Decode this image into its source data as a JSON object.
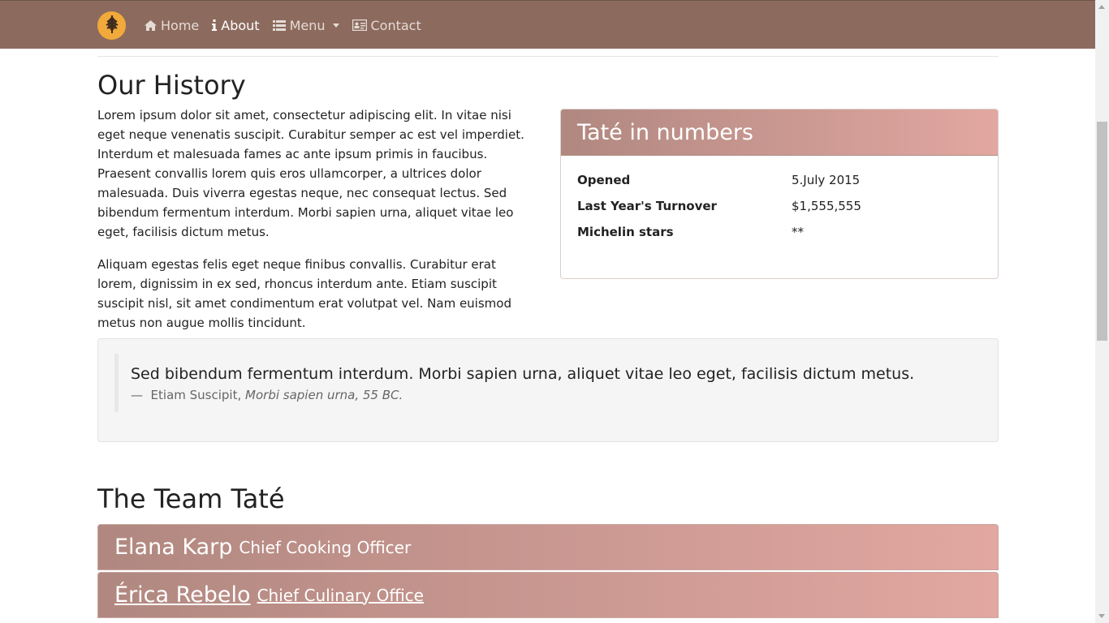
{
  "nav": {
    "brand_icon": "leaf-icon",
    "items": [
      {
        "label": "Home",
        "icon": "home-icon"
      },
      {
        "label": "About",
        "icon": "info-icon"
      },
      {
        "label": "Menu",
        "icon": "list-icon"
      },
      {
        "label": "Contact",
        "icon": "contact-card-icon"
      }
    ]
  },
  "history": {
    "title": "Our History",
    "paragraphs": [
      "Lorem ipsum dolor sit amet, consectetur adipiscing elit. In vitae nisi eget neque venenatis suscipit. Curabitur semper ac est vel imperdiet. Interdum et malesuada fames ac ante ipsum primis in faucibus. Praesent convallis lorem quis eros ullamcorper, a ultrices dolor malesuada. Duis viverra egestas neque, nec consequat lectus. Sed bibendum fermentum interdum. Morbi sapien urna, aliquet vitae leo eget, facilisis dictum metus.",
      "Aliquam egestas felis eget neque finibus convallis. Curabitur erat lorem, dignissim in ex sed, rhoncus interdum ante. Etiam suscipit suscipit nisl, sit amet condimentum erat volutpat vel. Nam euismod metus non augue mollis tincidunt."
    ]
  },
  "numbers": {
    "title": "Taté in numbers",
    "rows": [
      {
        "label": "Opened",
        "value": "5.July 2015"
      },
      {
        "label": "Last Year's Turnover",
        "value": "$1,555,555"
      },
      {
        "label": "Michelin stars",
        "value": "**"
      }
    ]
  },
  "quote": {
    "text": "Sed bibendum fermentum interdum. Morbi sapien urna, aliquet vitae leo eget, facilisis dictum metus.",
    "dash": "—",
    "author": "Etiam Suscipit,",
    "source": "Morbi sapien urna, 55 BC."
  },
  "team": {
    "title": "The Team Taté",
    "members": [
      {
        "name": "Elana Karp",
        "role": "Chief Cooking Officer"
      },
      {
        "name": "Érica Rebelo",
        "role": "Chief Culinary Office"
      }
    ]
  },
  "colors": {
    "navbar": "#8c6b5e",
    "accent_orange": "#f2a93b",
    "panel_gradient_start": "#b08880",
    "panel_gradient_end": "#e2a7a1"
  }
}
